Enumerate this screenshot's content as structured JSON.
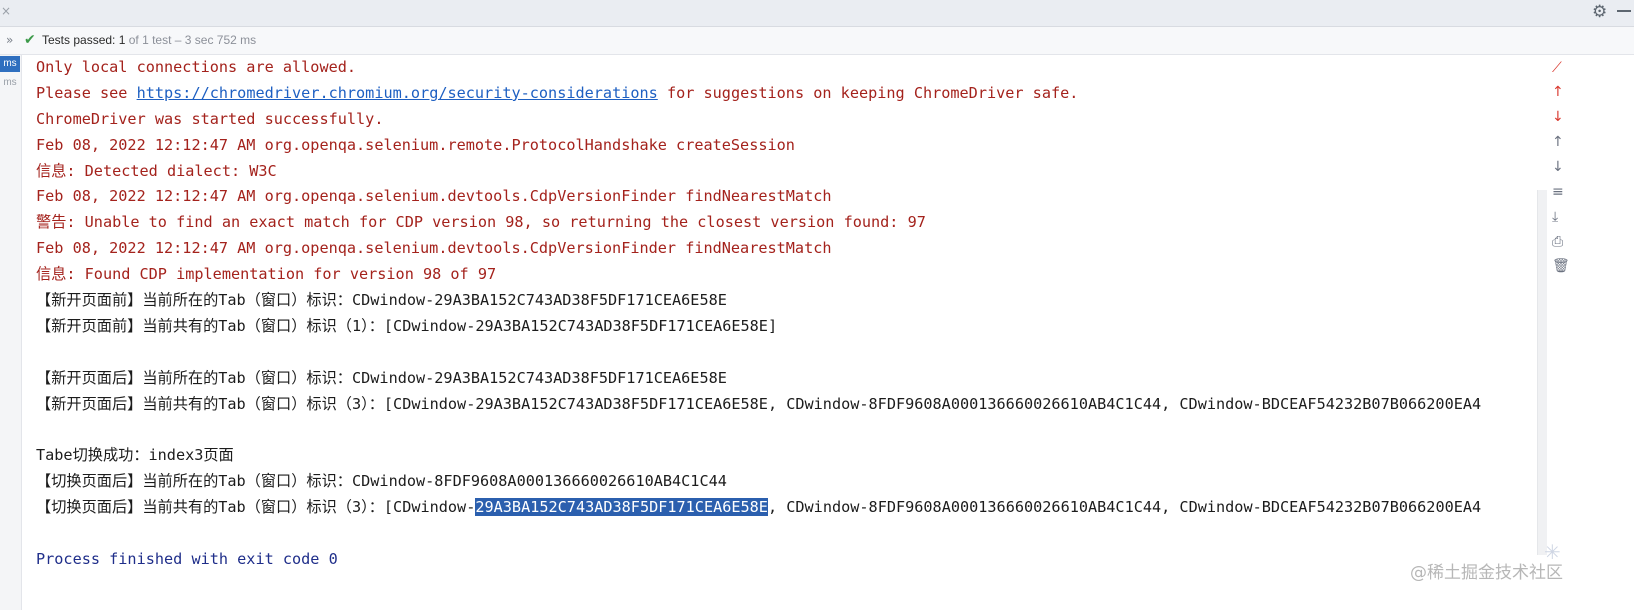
{
  "window": {
    "close_glyph": "×",
    "settings_icon": "gear-icon",
    "minimize_icon": "minus-icon"
  },
  "test_status": {
    "expand_glyph": "»",
    "check_glyph": "✔",
    "label": "Tests passed: ",
    "count": "1",
    "detail": " of 1 test – 3 sec 752 ms"
  },
  "gutter": {
    "badge_active": "ms",
    "badge_inactive": "ms"
  },
  "console": {
    "lines": [
      {
        "kind": "err",
        "text": "Only local connections are allowed."
      },
      {
        "kind": "err",
        "prefix": "Please see ",
        "link": "https://chromedriver.chromium.org/security-considerations",
        "suffix": " for suggestions on keeping ChromeDriver safe."
      },
      {
        "kind": "err",
        "text": "ChromeDriver was started successfully."
      },
      {
        "kind": "err",
        "text": "Feb 08, 2022 12:12:47 AM org.openqa.selenium.remote.ProtocolHandshake createSession"
      },
      {
        "kind": "err",
        "text": "信息: Detected dialect: W3C"
      },
      {
        "kind": "err",
        "text": "Feb 08, 2022 12:12:47 AM org.openqa.selenium.devtools.CdpVersionFinder findNearestMatch"
      },
      {
        "kind": "err",
        "text": "警告: Unable to find an exact match for CDP version 98, so returning the closest version found: 97"
      },
      {
        "kind": "err",
        "text": "Feb 08, 2022 12:12:47 AM org.openqa.selenium.devtools.CdpVersionFinder findNearestMatch"
      },
      {
        "kind": "err",
        "text": "信息: Found CDP implementation for version 98 of 97"
      },
      {
        "kind": "out",
        "text": "【新开页面前】当前所在的Tab（窗口）标识：CDwindow-29A3BA152C743AD38F5DF171CEA6E58E"
      },
      {
        "kind": "out",
        "text": "【新开页面前】当前共有的Tab（窗口）标识（1）：[CDwindow-29A3BA152C743AD38F5DF171CEA6E58E]"
      },
      {
        "kind": "out",
        "text": ""
      },
      {
        "kind": "out",
        "text": "【新开页面后】当前所在的Tab（窗口）标识：CDwindow-29A3BA152C743AD38F5DF171CEA6E58E"
      },
      {
        "kind": "out",
        "text": "【新开页面后】当前共有的Tab（窗口）标识（3）：[CDwindow-29A3BA152C743AD38F5DF171CEA6E58E, CDwindow-8FDF9608A000136660026610AB4C1C44, CDwindow-BDCEAF54232B07B066200EA4"
      },
      {
        "kind": "out",
        "text": ""
      },
      {
        "kind": "out",
        "text": "Tabe切换成功：index3页面"
      },
      {
        "kind": "out",
        "text": "【切换页面后】当前所在的Tab（窗口）标识：CDwindow-8FDF9608A000136660026610AB4C1C44"
      },
      {
        "kind": "out",
        "prefix": "【切换页面后】当前共有的Tab（窗口）标识（3）：[CDwindow-",
        "selected": "29A3BA152C743AD38F5DF171CEA6E58E",
        "suffix": ", CDwindow-8FDF9608A000136660026610AB4C1C44, CDwindow-BDCEAF54232B07B066200EA4"
      },
      {
        "kind": "out",
        "text": ""
      },
      {
        "kind": "exit",
        "text": "Process finished with exit code 0"
      }
    ]
  },
  "toolbar": {
    "buttons": [
      {
        "name": "rerun-failed-icon",
        "glyph": "⟋",
        "red": true
      },
      {
        "name": "arrow-up-red-icon",
        "glyph": "↑",
        "red": true
      },
      {
        "name": "arrow-down-red-icon",
        "glyph": "↓",
        "red": true
      },
      {
        "name": "arrow-up-icon",
        "glyph": "↑",
        "red": false
      },
      {
        "name": "arrow-down-icon",
        "glyph": "↓",
        "red": false
      },
      {
        "name": "soft-wrap-icon",
        "glyph": "≡",
        "red": false
      },
      {
        "name": "scroll-to-end-icon",
        "glyph": "⤓",
        "red": false
      },
      {
        "name": "print-icon",
        "glyph": "⎙",
        "red": false
      },
      {
        "name": "trash-icon",
        "glyph": "🗑",
        "red": false
      }
    ]
  },
  "watermark": {
    "text": "@稀土掘金技术社区"
  },
  "colors": {
    "error_text": "#a4221c",
    "link": "#1d5fc2",
    "exit_text": "#1f2e8a",
    "selection": "#2b5fae",
    "pass_check": "#3d9a4a",
    "gutter_badge": "#2f6fbf"
  }
}
